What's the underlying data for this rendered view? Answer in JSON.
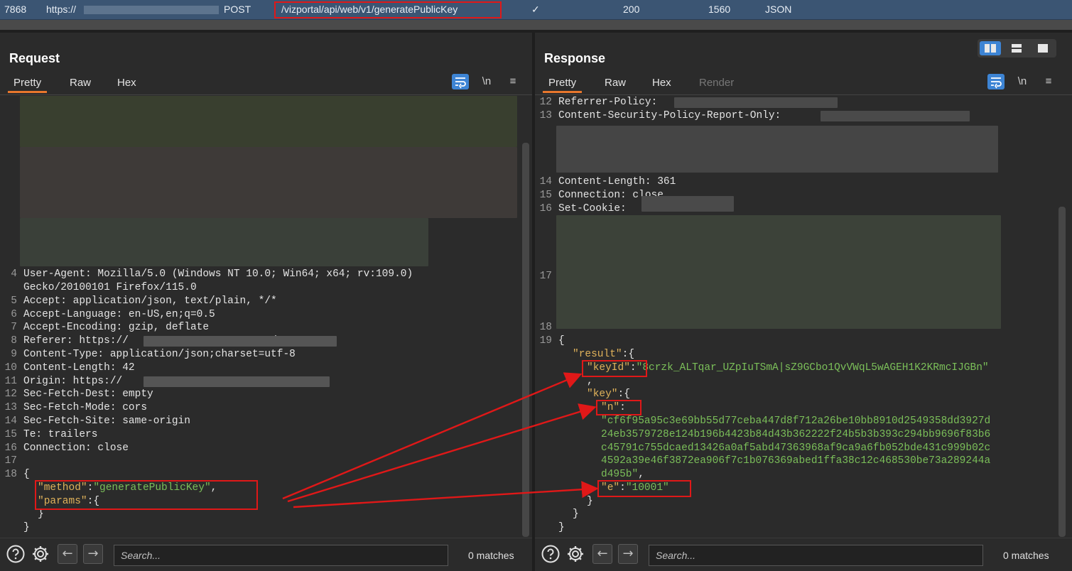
{
  "history": {
    "id": "7868",
    "url": "https://",
    "method": "POST",
    "path": "/vizportal/api/web/v1/generatePublicKey",
    "check": "✓",
    "status": "200",
    "length": "1560",
    "mime": "JSON"
  },
  "request": {
    "title": "Request",
    "tabs": [
      "Pretty",
      "Raw",
      "Hex"
    ],
    "tools": {
      "wrap": "wrap-lines-icon",
      "newline": "\\n",
      "menu": "≡"
    },
    "lines": [
      {
        "n": "4",
        "text": "User-Agent: Mozilla/5.0 (Windows NT 10.0; Win64; x64; rv:109.0)"
      },
      {
        "n": "",
        "text": "Gecko/20100101 Firefox/115.0"
      },
      {
        "n": "5",
        "text": "Accept: application/json, text/plain, */*"
      },
      {
        "n": "6",
        "text": "Accept-Language: en-US,en;q=0.5"
      },
      {
        "n": "7",
        "text": "Accept-Encoding: gzip, deflate"
      },
      {
        "n": "8",
        "text": "Referer: https://                       /"
      },
      {
        "n": "9",
        "text": "Content-Type: application/json;charset=utf-8"
      },
      {
        "n": "10",
        "text": "Content-Length: 42"
      },
      {
        "n": "11",
        "text": "Origin: https://"
      },
      {
        "n": "12",
        "text": "Sec-Fetch-Dest: empty"
      },
      {
        "n": "13",
        "text": "Sec-Fetch-Mode: cors"
      },
      {
        "n": "14",
        "text": "Sec-Fetch-Site: same-origin"
      },
      {
        "n": "15",
        "text": "Te: trailers"
      },
      {
        "n": "16",
        "text": "Connection: close"
      },
      {
        "n": "17",
        "text": ""
      },
      {
        "n": "18",
        "text": "{"
      }
    ],
    "body": {
      "method_key": "\"method\"",
      "method_val": "\"generatePublicKey\"",
      "params_key": "\"params\"",
      "params_open": ":{",
      "inner_close": "}",
      "close": "}"
    },
    "search_placeholder": "Search...",
    "matches": "0 matches"
  },
  "response": {
    "title": "Response",
    "tabs": [
      "Pretty",
      "Raw",
      "Hex",
      "Render"
    ],
    "tools": {
      "wrap": "wrap-lines-icon",
      "newline": "\\n",
      "menu": "≡"
    },
    "lines": [
      {
        "n": "12",
        "text": "Referrer-Policy:"
      },
      {
        "n": "13",
        "text": "Content-Security-Policy-Report-Only:"
      },
      {
        "n": "14",
        "text": "Content-Length: 361"
      },
      {
        "n": "15",
        "text": "Connection: close"
      },
      {
        "n": "16",
        "text": "Set-Cookie:"
      },
      {
        "n": "17",
        "text": ""
      },
      {
        "n": "18",
        "text": ""
      },
      {
        "n": "19",
        "text": "{"
      }
    ],
    "body": {
      "result_key": "\"result\"",
      "keyid_key": "\"keyId\"",
      "keyid_val": "\"8crzk_ALTqar_UZpIuTSmA|sZ9GCbo1QvVWqL5wAGEH1K2KRmcIJGBn\"",
      "comma": ",",
      "key_key": "\"key\"",
      "n_key": "\"n\"",
      "n_val_1": "\"cf6f95a95c3e69bb55d77ceba447d8f712a26be10bb8910d2549358dd3927d",
      "n_val_2": "24eb3579728e124b196b4423b84d43b362222f24b5b3b393c294bb9696f83b6",
      "n_val_3": "c45791c755dcaed13426a0af5abd47363968af9ca9a6fb052bde431c999b02c",
      "n_val_4": "4592a39e46f3872ea906f7c1b076369abed1ffa38c12c468530be73a289244a",
      "n_val_5": "d495b\"",
      "e_key": "\"e\"",
      "e_val": "\"10001\"",
      "close": "}"
    },
    "search_placeholder": "Search...",
    "matches": "0 matches"
  },
  "colors": {
    "accent": "#e8762c",
    "highlight_box": "#e01818",
    "json_key": "#e0b25a",
    "json_string": "#7bbf59",
    "history_row": "#3b5573"
  }
}
